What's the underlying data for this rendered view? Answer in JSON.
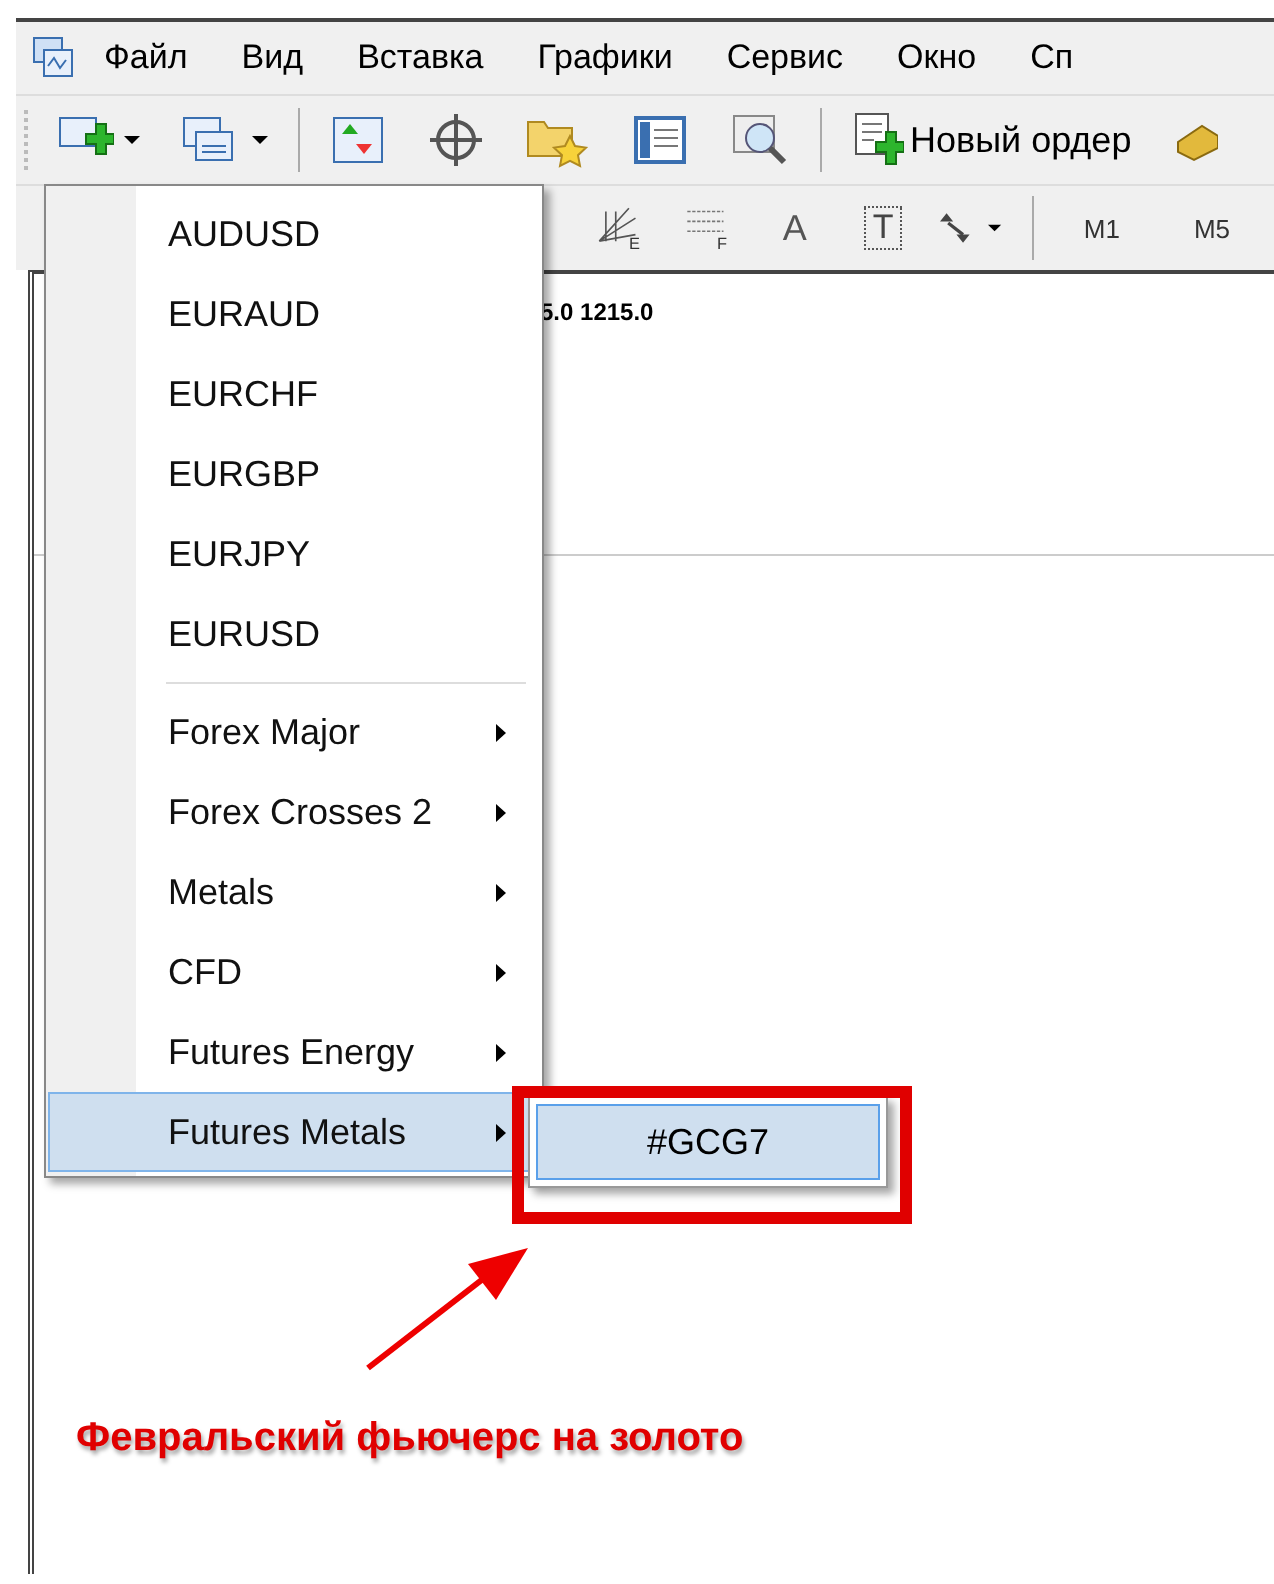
{
  "menubar": {
    "items": [
      "Файл",
      "Вид",
      "Вставка",
      "Графики",
      "Сервис",
      "Окно",
      "Сп"
    ]
  },
  "toolbar": {
    "new_order_label": "Новый ордер"
  },
  "toolbar_2": {
    "fibo_fan_letter": "E",
    "fibo_lines_letter": "F",
    "text_tool": "A",
    "label_tool": "T",
    "timeframes": [
      "M1",
      "M5"
    ]
  },
  "chart": {
    "header": "5.0 1215.0"
  },
  "symbol_menu": {
    "symbols": [
      {
        "label": "AUDUSD",
        "selected": false
      },
      {
        "label": "EURAUD",
        "selected": false
      },
      {
        "label": "EURCHF",
        "selected": false
      },
      {
        "label": "EURGBP",
        "selected": false
      },
      {
        "label": "EURJPY",
        "selected": false
      },
      {
        "label": "EURUSD",
        "selected": false
      }
    ],
    "groups": [
      {
        "label": "Forex Major",
        "selected": false
      },
      {
        "label": "Forex Crosses 2",
        "selected": false
      },
      {
        "label": "Metals",
        "selected": false
      },
      {
        "label": "CFD",
        "selected": false
      },
      {
        "label": "Futures Energy",
        "selected": false
      },
      {
        "label": "Futures Metals",
        "selected": true
      }
    ]
  },
  "submenu": {
    "items": [
      {
        "label": "#GCG7",
        "selected": true
      }
    ]
  },
  "annotation": {
    "text": "Февральский фьючерс на золото"
  }
}
